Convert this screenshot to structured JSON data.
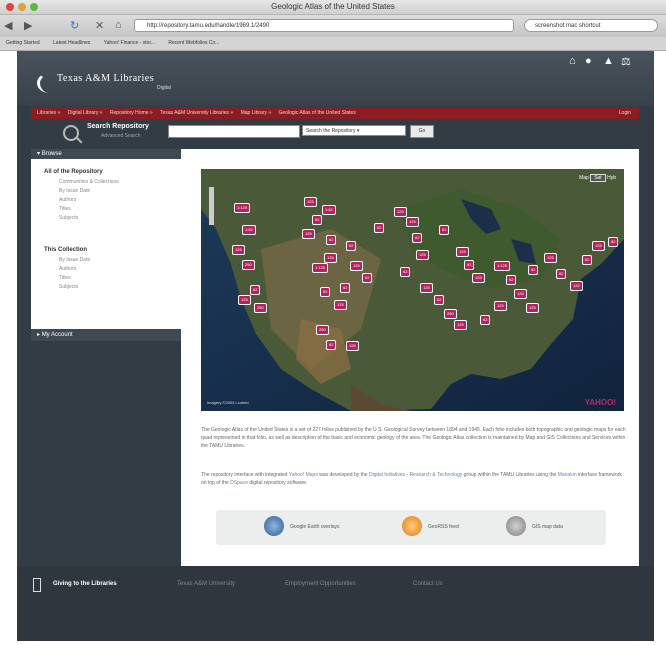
{
  "browser": {
    "window_title": "Geologic Atlas of the United States",
    "url": "http://repository.tamu.edu/handle/1969.1/2490",
    "search_text": "screenshot mac shortcut",
    "bookmarks": [
      "Getting Started",
      "Latest Headlines",
      "Yahoo! Finance - stor...",
      "Recent Webfolios Co..."
    ]
  },
  "site": {
    "logo": "Texas A&M Libraries",
    "logo_sub": "Digital",
    "breadcrumbs": [
      "Libraries",
      "Digital Library",
      "Repository Home",
      "Texas A&M University Libraries",
      "Map Library",
      "Geologic Atlas of the United States"
    ],
    "login": "Login",
    "search": {
      "label": "Search Repository",
      "advanced": "Advanced Search",
      "scope": "Search the Repository",
      "go": "Go"
    }
  },
  "sidebar": {
    "header": "Browse",
    "all_title": "All of the Repository",
    "all_items": [
      "Communities & Collections",
      "By Issue Date",
      "Authors",
      "Titles",
      "Subjects"
    ],
    "col_title": "This Collection",
    "col_items": [
      "By Issue Date",
      "Authors",
      "Titles",
      "Subjects"
    ],
    "my_account": "My Account"
  },
  "map": {
    "type_options": [
      "Map",
      "Sat",
      "Hyb"
    ],
    "selected": "Sat",
    "brand": "YAHOO!",
    "scale": "Imagery ©2004 i-cubed",
    "markers": [
      "1:125",
      "1:62",
      "125",
      "250",
      "62",
      "125",
      "250",
      "125",
      "62",
      "125",
      "1:62",
      "62",
      "125",
      "62",
      "1:125",
      "62",
      "62",
      "125",
      "62",
      "125",
      "250",
      "62",
      "125",
      "62",
      "125",
      "125",
      "62",
      "125",
      "62",
      "125",
      "62",
      "250",
      "125",
      "62",
      "125",
      "62",
      "125",
      "1:125",
      "62",
      "125",
      "62",
      "125",
      "62",
      "125",
      "62",
      "125",
      "62",
      "125",
      "62",
      "125"
    ]
  },
  "content": {
    "p1": "The Geologic Atlas of the United States is a set of 227 folios published by the U.S. Geological Survey between 1894 and 1945. Each folio includes both topographic and geologic maps for each quad represented in that folio, as well as description of the basic and economic geology of the area. The Geologic Atlas collection is maintained by Map and GIS Collections and Services within the TAMU Libraries.",
    "p2a": "The repository interface with integrated ",
    "p2_link1": "Yahoo! Maps",
    "p2b": " was developed by the ",
    "p2_link2": "Digital Initiatives - Research & Technology",
    "p2c": " group within the TAMU Libraries using the ",
    "p2_link3": "Manakin",
    "p2d": " interface framework on top of the ",
    "p2_link4": "DSpace",
    "p2e": " digital repository software.",
    "tools": [
      "Google Earth overlays",
      "GeoRSS feed",
      "GIS map data"
    ]
  },
  "footer": {
    "giving": "Giving to the Libraries",
    "links": [
      "Texas A&M University",
      "Employment Opportunities",
      "Contact Us"
    ]
  }
}
